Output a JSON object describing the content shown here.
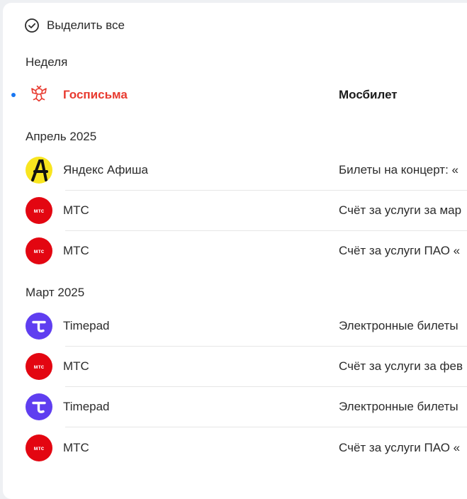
{
  "toolbar": {
    "select_all_label": "Выделить все"
  },
  "groups": [
    {
      "title": "Неделя",
      "items": [
        {
          "sender": "Госписьма",
          "subject": "Мосбилет",
          "icon": "gosuslugi-eagle-icon",
          "unread": true
        }
      ]
    },
    {
      "title": "Апрель 2025",
      "items": [
        {
          "sender": "Яндекс Афиша",
          "subject": "Билеты на концерт: «",
          "icon": "yandex-afisha-icon"
        },
        {
          "sender": "МТС",
          "subject": "Счёт за услуги за мар",
          "icon": "mts-logo-icon",
          "logo_text": "мтс"
        },
        {
          "sender": "МТС",
          "subject": "Счёт за услуги ПАО «",
          "icon": "mts-logo-icon",
          "logo_text": "мтс"
        }
      ]
    },
    {
      "title": "Март 2025",
      "items": [
        {
          "sender": "Timepad",
          "subject": "Электронные билеты",
          "icon": "timepad-logo-icon"
        },
        {
          "sender": "МТС",
          "subject": "Счёт за услуги за фев",
          "icon": "mts-logo-icon",
          "logo_text": "мтс"
        },
        {
          "sender": "Timepad",
          "subject": "Электронные билеты",
          "icon": "timepad-logo-icon"
        },
        {
          "sender": "МТС",
          "subject": "Счёт за услуги ПАО «",
          "icon": "mts-logo-icon",
          "logo_text": "мтс"
        }
      ]
    }
  ],
  "colors": {
    "accent_blue": "#1877f2",
    "gos_red": "#e83a2f",
    "mts_red": "#e30611",
    "timepad_purple": "#5f3ef0",
    "afisha_yellow": "#f9e51f"
  }
}
